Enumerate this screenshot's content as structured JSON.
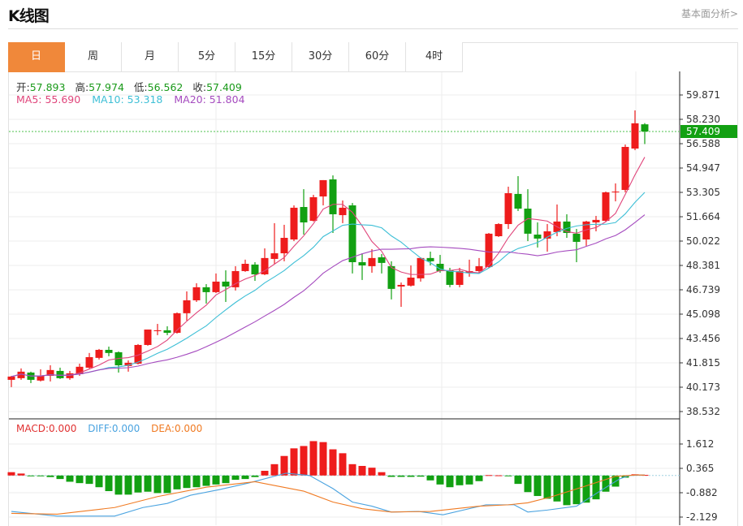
{
  "header": {
    "title": "K线图",
    "fundamental_link": "基本面分析>"
  },
  "tabs": [
    {
      "label": "日",
      "active": true
    },
    {
      "label": "周"
    },
    {
      "label": "月"
    },
    {
      "label": "5分"
    },
    {
      "label": "15分"
    },
    {
      "label": "30分"
    },
    {
      "label": "60分"
    },
    {
      "label": "4时"
    }
  ],
  "ohlc": {
    "open_label": "开:",
    "open": "57.893",
    "high_label": "高:",
    "high": "57.974",
    "low_label": "低:",
    "low": "56.562",
    "close_label": "收:",
    "close": "57.409"
  },
  "ma": {
    "ma5": "MA5: 55.690",
    "ma10": "MA10: 53.318",
    "ma20": "MA20: 51.804"
  },
  "macd_labels": {
    "macd": "MACD:0.000",
    "diff": "DIFF:0.000",
    "dea": "DEA:0.000"
  },
  "colors": {
    "up": "#ee1c1c",
    "down": "#12a012",
    "ma5": "#e0457b",
    "ma10": "#3dbfd6",
    "ma20": "#a54bbf",
    "diff": "#4aa3e0",
    "dea": "#f07a22",
    "active_tab": "#f0883a",
    "last_price_bg": "#12a012"
  },
  "chart_data": {
    "type": "candlestick",
    "price_axis": {
      "ticks": [
        "59.871",
        "58.230",
        "56.588",
        "54.947",
        "53.305",
        "51.664",
        "50.022",
        "48.381",
        "46.739",
        "45.098",
        "43.456",
        "41.815",
        "40.173",
        "38.532"
      ],
      "range": [
        38.532,
        59.871
      ]
    },
    "last_price": "57.409",
    "candles": [
      [
        40.67,
        40.94,
        40.18,
        40.89
      ],
      [
        40.78,
        41.44,
        40.67,
        41.22
      ],
      [
        41.16,
        41.22,
        40.45,
        40.67
      ],
      [
        40.62,
        41.38,
        40.56,
        40.94
      ],
      [
        40.94,
        41.65,
        40.56,
        41.33
      ],
      [
        41.27,
        41.49,
        40.73,
        40.78
      ],
      [
        40.78,
        41.27,
        40.67,
        41.11
      ],
      [
        41.05,
        41.76,
        40.94,
        41.55
      ],
      [
        41.49,
        42.48,
        41.44,
        42.2
      ],
      [
        42.15,
        42.75,
        42.04,
        42.69
      ],
      [
        42.69,
        42.91,
        42.26,
        42.48
      ],
      [
        42.53,
        42.58,
        41.16,
        41.65
      ],
      [
        41.6,
        41.98,
        41.22,
        41.82
      ],
      [
        41.76,
        43.08,
        41.71,
        43.02
      ],
      [
        43.02,
        44.06,
        42.97,
        44.06
      ],
      [
        43.95,
        44.44,
        43.68,
        44.01
      ],
      [
        44.01,
        44.28,
        43.68,
        43.84
      ],
      [
        43.84,
        45.21,
        43.79,
        45.16
      ],
      [
        45.16,
        46.63,
        44.66,
        46.03
      ],
      [
        46.03,
        47.18,
        45.92,
        46.91
      ],
      [
        46.91,
        47.12,
        45.81,
        46.58
      ],
      [
        46.58,
        47.84,
        46.52,
        47.29
      ],
      [
        47.29,
        48.05,
        45.92,
        46.96
      ],
      [
        46.91,
        48.33,
        46.69,
        48.0
      ],
      [
        48.0,
        48.77,
        47.95,
        48.49
      ],
      [
        48.44,
        48.6,
        47.34,
        47.78
      ],
      [
        47.78,
        49.53,
        47.73,
        48.88
      ],
      [
        48.82,
        51.23,
        48.49,
        49.2
      ],
      [
        49.2,
        51.12,
        48.66,
        50.24
      ],
      [
        50.13,
        52.43,
        50.02,
        52.27
      ],
      [
        52.32,
        53.52,
        50.46,
        51.28
      ],
      [
        51.39,
        53.14,
        51.34,
        52.98
      ],
      [
        53.03,
        54.13,
        52.43,
        54.13
      ],
      [
        54.18,
        54.45,
        50.57,
        51.83
      ],
      [
        51.77,
        52.76,
        51.23,
        52.27
      ],
      [
        52.43,
        52.59,
        47.84,
        48.6
      ],
      [
        48.6,
        49.2,
        47.4,
        48.38
      ],
      [
        48.33,
        49.48,
        47.89,
        48.88
      ],
      [
        48.93,
        49.15,
        47.84,
        48.55
      ],
      [
        48.33,
        48.66,
        46.09,
        46.8
      ],
      [
        46.96,
        47.23,
        45.59,
        47.07
      ],
      [
        47.02,
        48.38,
        46.96,
        47.56
      ],
      [
        47.51,
        48.93,
        47.29,
        48.88
      ],
      [
        48.88,
        49.31,
        48.38,
        48.66
      ],
      [
        48.49,
        49.09,
        47.89,
        48.0
      ],
      [
        48.05,
        48.22,
        46.91,
        47.07
      ],
      [
        47.07,
        48.22,
        46.91,
        48.0
      ],
      [
        47.89,
        48.77,
        47.62,
        48.0
      ],
      [
        48.0,
        48.88,
        47.84,
        48.33
      ],
      [
        48.27,
        50.57,
        48.22,
        50.52
      ],
      [
        50.35,
        51.23,
        50.3,
        51.17
      ],
      [
        51.17,
        53.69,
        50.84,
        53.25
      ],
      [
        53.2,
        54.4,
        52.05,
        52.21
      ],
      [
        52.21,
        53.52,
        50.02,
        50.52
      ],
      [
        50.46,
        51.28,
        49.59,
        50.19
      ],
      [
        50.19,
        51.17,
        49.31,
        50.68
      ],
      [
        50.63,
        52.49,
        50.35,
        51.34
      ],
      [
        51.34,
        51.83,
        50.24,
        50.57
      ],
      [
        50.52,
        50.84,
        48.6,
        49.97
      ],
      [
        50.13,
        51.39,
        49.7,
        51.34
      ],
      [
        51.28,
        51.72,
        50.68,
        51.45
      ],
      [
        51.39,
        53.36,
        51.34,
        53.31
      ],
      [
        53.31,
        53.91,
        52.7,
        53.36
      ],
      [
        53.47,
        56.53,
        53.31,
        56.37
      ],
      [
        56.26,
        58.83,
        56.15,
        57.96
      ],
      [
        57.893,
        57.974,
        56.562,
        57.409
      ]
    ],
    "macd_axis": {
      "ticks": [
        "1.612",
        "0.365",
        "-0.882",
        "-2.129"
      ]
    },
    "macd_hist": [
      0.17,
      0.1,
      -0.04,
      -0.04,
      -0.08,
      -0.18,
      -0.32,
      -0.39,
      -0.43,
      -0.6,
      -0.8,
      -0.98,
      -0.98,
      -0.87,
      -0.83,
      -0.9,
      -0.9,
      -0.71,
      -0.64,
      -0.6,
      -0.53,
      -0.46,
      -0.39,
      -0.22,
      -0.18,
      -0.08,
      0.24,
      0.58,
      1.0,
      1.39,
      1.51,
      1.76,
      1.71,
      1.34,
      1.14,
      0.58,
      0.49,
      0.4,
      0.17,
      -0.07,
      -0.07,
      -0.07,
      -0.06,
      -0.25,
      -0.46,
      -0.6,
      -0.5,
      -0.46,
      -0.29,
      0.02,
      0.01,
      -0.01,
      -0.43,
      -0.85,
      -1.05,
      -1.19,
      -1.33,
      -1.52,
      -1.47,
      -1.39,
      -1.22,
      -0.83,
      -0.57,
      -0.11,
      0.06,
      0.03
    ],
    "diff": [
      [
        0,
        -1.84
      ],
      [
        4.7,
        -2.08
      ],
      [
        10.6,
        -2.08
      ],
      [
        13.5,
        -1.64
      ],
      [
        16,
        -1.43
      ],
      [
        18.4,
        -1.01
      ],
      [
        21.3,
        -0.73
      ],
      [
        24.3,
        -0.39
      ],
      [
        28.2,
        0.12
      ],
      [
        30.6,
        0
      ],
      [
        33,
        -0.67
      ],
      [
        35,
        -1.36
      ],
      [
        37,
        -1.57
      ],
      [
        39,
        -1.87
      ],
      [
        41.8,
        -1.84
      ],
      [
        44.3,
        -2.01
      ],
      [
        48.7,
        -1.5
      ],
      [
        51.6,
        -1.5
      ],
      [
        53,
        -1.87
      ],
      [
        55,
        -1.77
      ],
      [
        58,
        -1.57
      ],
      [
        60.4,
        -0.8
      ],
      [
        62.4,
        -0.18
      ],
      [
        63.4,
        0
      ],
      [
        65,
        0.03
      ]
    ],
    "dea": [
      [
        0,
        -1.94
      ],
      [
        4.7,
        -1.98
      ],
      [
        10.6,
        -1.64
      ],
      [
        15,
        -1.08
      ],
      [
        20,
        -0.6
      ],
      [
        25,
        -0.32
      ],
      [
        30,
        -0.8
      ],
      [
        33,
        -1.36
      ],
      [
        36,
        -1.7
      ],
      [
        39,
        -1.87
      ],
      [
        43,
        -1.84
      ],
      [
        48,
        -1.57
      ],
      [
        51,
        -1.5
      ],
      [
        53,
        -1.4
      ],
      [
        55.5,
        -1.08
      ],
      [
        59,
        -0.53
      ],
      [
        62,
        -0.04
      ],
      [
        64.3,
        0.03
      ],
      [
        65,
        0.02
      ]
    ]
  }
}
